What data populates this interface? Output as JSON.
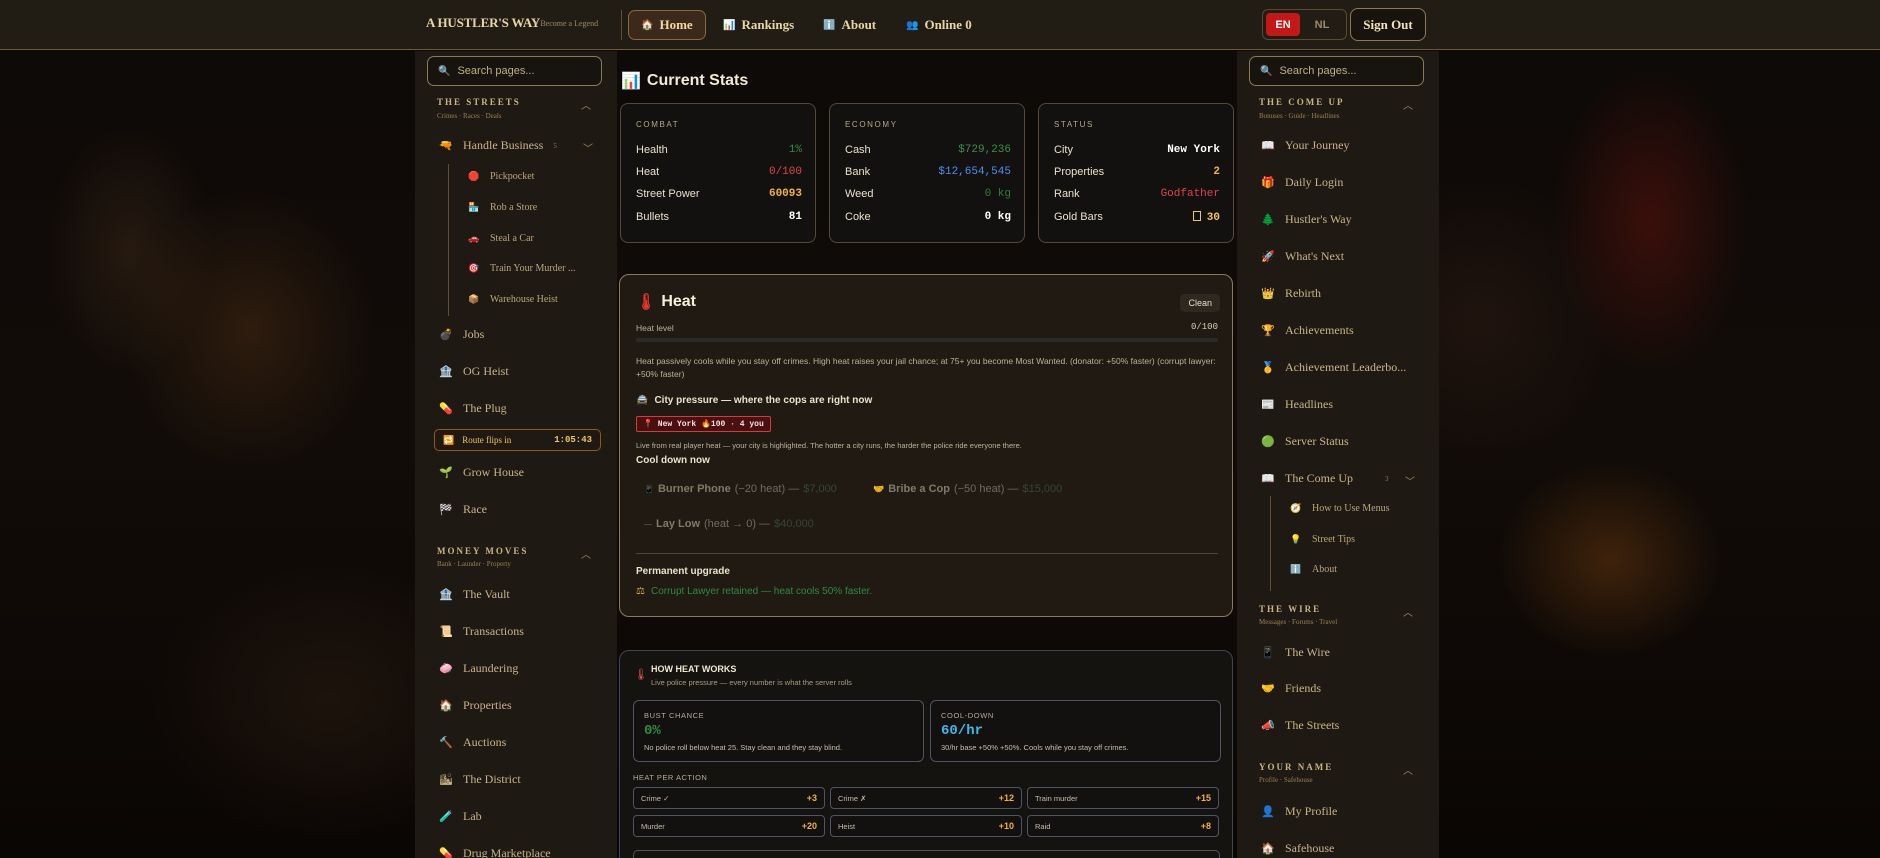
{
  "header": {
    "logo": "A HUSTLER'S WAY",
    "tagline": "~ Become a Legend",
    "nav": [
      {
        "icon": "🏠",
        "label": "Home"
      },
      {
        "icon": "📊",
        "label": "Rankings"
      },
      {
        "icon": "ℹ️",
        "label": "About"
      },
      {
        "icon": "👥",
        "label": "Online 0"
      }
    ],
    "lang_en": "EN",
    "lang_nl": "NL",
    "signout": "Sign Out"
  },
  "left": {
    "search_placeholder": "Search pages...",
    "sec1_title": "THE STREETS",
    "sec1_sub": "Crimes · Races · Deals",
    "handle": "Handle Business",
    "handle_count": "5",
    "subs": [
      {
        "icon": "🛑",
        "label": "Pickpocket"
      },
      {
        "icon": "🏪",
        "label": "Rob a Store"
      },
      {
        "icon": "🚗",
        "label": "Steal a Car"
      },
      {
        "icon": "🎯",
        "label": "Train Your Murder ..."
      },
      {
        "icon": "📦",
        "label": "Warehouse Heist"
      }
    ],
    "items1": [
      {
        "icon": "💣",
        "label": "Jobs"
      },
      {
        "icon": "🏦",
        "label": "OG Heist"
      },
      {
        "icon": "💊",
        "label": "The Plug"
      }
    ],
    "route_label": "Route flips in",
    "route_time": "1:05:43",
    "items2": [
      {
        "icon": "🌱",
        "label": "Grow House"
      },
      {
        "icon": "🏁",
        "label": "Race"
      }
    ],
    "sec2_title": "MONEY MOVES",
    "sec2_sub": "Bank · Launder · Property",
    "items3": [
      {
        "icon": "🏦",
        "label": "The Vault"
      },
      {
        "icon": "📜",
        "label": "Transactions"
      },
      {
        "icon": "🧼",
        "label": "Laundering"
      },
      {
        "icon": "🏠",
        "label": "Properties"
      },
      {
        "icon": "🔨",
        "label": "Auctions"
      },
      {
        "icon": "🏙",
        "label": "The District"
      },
      {
        "icon": "🧪",
        "label": "Lab"
      },
      {
        "icon": "💊",
        "label": "Drug Marketplace"
      }
    ]
  },
  "right": {
    "search_placeholder": "Search pages...",
    "sec1_title": "THE COME UP",
    "sec1_sub": "Bonuses · Guide · Headlines",
    "items1": [
      {
        "icon": "📖",
        "label": "Your Journey"
      },
      {
        "icon": "🎁",
        "label": "Daily Login"
      },
      {
        "icon": "🌲",
        "label": "Hustler's Way"
      },
      {
        "icon": "🚀",
        "label": "What's Next"
      },
      {
        "icon": "👑",
        "label": "Rebirth"
      },
      {
        "icon": "🏆",
        "label": "Achievements"
      },
      {
        "icon": "🥇",
        "label": "Achievement Leaderbo..."
      },
      {
        "icon": "📰",
        "label": "Headlines"
      },
      {
        "icon": "🟢",
        "label": "Server Status"
      }
    ],
    "comeup": "The Come Up",
    "comeup_count": "3",
    "subs": [
      {
        "icon": "🧭",
        "label": "How to Use Menus"
      },
      {
        "icon": "💡",
        "label": "Street Tips"
      },
      {
        "icon": "ℹ️",
        "label": "About"
      }
    ],
    "sec2_title": "THE WIRE",
    "sec2_sub": "Messages · Forums · Travel",
    "items2": [
      {
        "icon": "📱",
        "label": "The Wire"
      },
      {
        "icon": "🤝",
        "label": "Friends"
      },
      {
        "icon": "📣",
        "label": "The Streets"
      }
    ],
    "sec3_title": "YOUR NAME",
    "sec3_sub": "Profile · Safehouse",
    "items3": [
      {
        "icon": "👤",
        "label": "My Profile"
      },
      {
        "icon": "🏠",
        "label": "Safehouse"
      }
    ]
  },
  "stats": {
    "title": "Current Stats",
    "icon": "📊",
    "combat": {
      "h": "COMBAT",
      "rows": [
        [
          "Health",
          "1%"
        ],
        [
          "Heat",
          "0/100"
        ],
        [
          "Street Power",
          "60093"
        ],
        [
          "Bullets",
          "81"
        ]
      ]
    },
    "economy": {
      "h": "ECONOMY",
      "rows": [
        [
          "Cash",
          "$729,236"
        ],
        [
          "Bank",
          "$12,654,545"
        ],
        [
          "Weed",
          "0 kg"
        ],
        [
          "Coke",
          "0 kg"
        ]
      ]
    },
    "status": {
      "h": "STATUS",
      "rows": [
        [
          "City",
          "New York"
        ],
        [
          "Properties",
          "2"
        ],
        [
          "Rank",
          "Godfather"
        ],
        [
          "Gold Bars",
          "30"
        ]
      ]
    }
  },
  "colors": {
    "health": "#2e8b3e",
    "heat": "#e0434b",
    "power": "#f2b33d",
    "cash": "#3a8f4a",
    "bank": "#4d8ef0",
    "rank": "#e0434b",
    "gold": "#f2c458",
    "red_lang": "#c41818"
  },
  "heat": {
    "title": "Heat",
    "badge": "Clean",
    "level_label": "Heat level",
    "level_value": "0/100",
    "level_fraction": 0,
    "desc": "Heat passively cools while you stay off crimes. High heat raises your jail chance; at 75+ you become Most Wanted. (donator: +50% faster) (corrupt lawyer: +50% faster)",
    "pressure": "City pressure — where the cops are right now",
    "city": "📍 New York 🔥100 · 4 you",
    "live": "Live from real player heat — your city is highlighted. The hotter a city runs, the harder the police ride everyone there.",
    "cooldown": "Cool down now",
    "btn1_name": "Burner Phone",
    "btn1_detail": "(−20 heat) —",
    "btn1_price": "$7,000",
    "btn2_name": "Bribe a Cop",
    "btn2_detail": "(−50 heat) —",
    "btn2_price": "$15,000",
    "btn3_name": "Lay Low",
    "btn3_detail": "(heat → 0) —",
    "btn3_price": "$40,000",
    "perm_title": "Permanent upgrade",
    "perm_text": "Corrupt Lawyer retained — heat cools 50% faster."
  },
  "how": {
    "title": "HOW HEAT WORKS",
    "sub": "Live police pressure — every number is what the server rolls",
    "bust_label": "BUST CHANCE",
    "bust_value": "0%",
    "bust_desc": "No police roll below heat 25. Stay clean and they stay blind.",
    "cd_label": "COOL-DOWN",
    "cd_value": "60/hr",
    "cd_desc": "30/hr base +50% +50%. Cools while you stay off crimes.",
    "hpa": "HEAT PER ACTION",
    "chips": [
      [
        "Crime ✓",
        "+3"
      ],
      [
        "Crime ✗",
        "+12"
      ],
      [
        "Train murder",
        "+15"
      ],
      [
        "Murder",
        "+20"
      ],
      [
        "Heist",
        "+10"
      ],
      [
        "Raid",
        "+8"
      ]
    ]
  }
}
